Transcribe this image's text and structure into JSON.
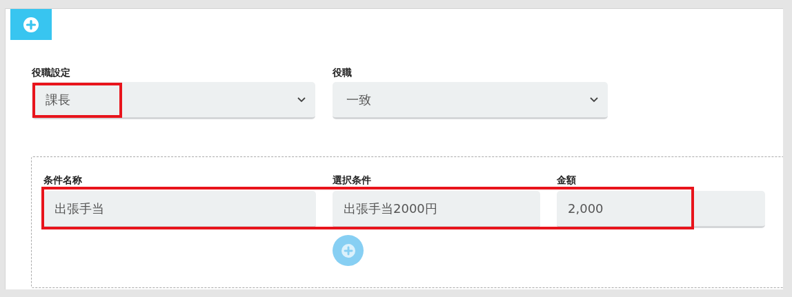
{
  "selects": [
    {
      "label": "役職設定",
      "value": "課長",
      "highlighted": true
    },
    {
      "label": "役職",
      "value": "一致",
      "highlighted": false
    }
  ],
  "condition": {
    "highlighted": true,
    "fields": [
      {
        "label": "条件名称",
        "value": "出張手当"
      },
      {
        "label": "選択条件",
        "value": "出張手当2000円"
      },
      {
        "label": "金額",
        "value": "2,000"
      }
    ]
  }
}
